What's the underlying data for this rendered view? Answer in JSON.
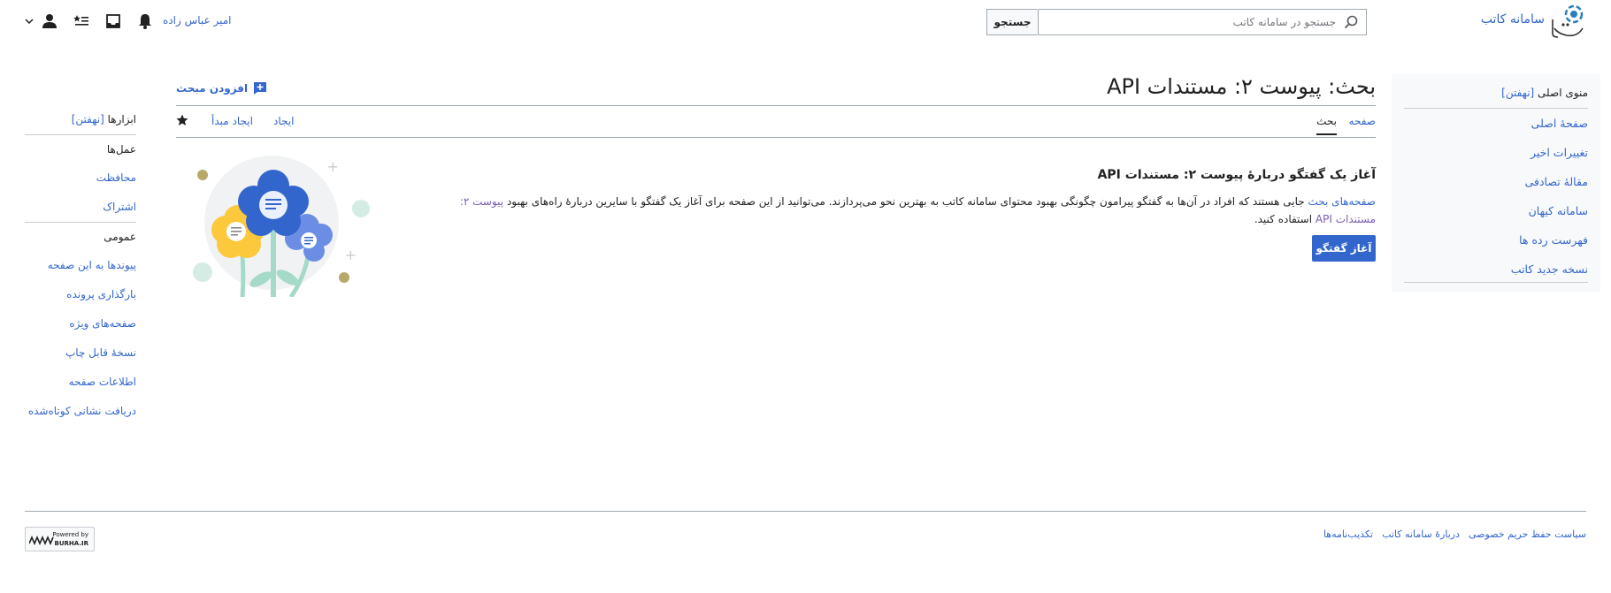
{
  "header": {
    "site_name": "سامانه کاتب",
    "search_placeholder": "جستجو در سامانه کاتب",
    "search_button": "جستجو",
    "username": "امیر عباس زاده"
  },
  "main_menu": {
    "title": "منوی اصلی",
    "hide": "[نهفتن]",
    "items": [
      "صفحهٔ اصلی",
      "تغییرات اخیر",
      "مقالهٔ تصادفی",
      "سامانه کیهان",
      "فهرست رده ها",
      "نسخه جدید کاتب"
    ]
  },
  "page": {
    "title": "بحث: پیوست ۲: مستندات API",
    "add_topic": "افزودن مبحث",
    "tabs": {
      "page": "صفحه",
      "talk": "بحث",
      "create": "ایجاد",
      "create_source": "ایجاد مبدأ"
    }
  },
  "empty_state": {
    "heading": "آغاز یک گفتگو دربارهٔ پیوست ۲: مستندات API",
    "link_talk_pages": "صفحه‌های بحث",
    "desc_part1": " جایی هستند که افراد در آن‌ها به گفتگو پیرامون چگونگی بهبود محتوای سامانه کاتب به بهترین نحو می‌پردازند. می‌توانید از این صفحه برای آغاز یک گفتگو با سایرین دربارهٔ راه‌های بهبود ",
    "link_page": "پیوست ۲: مستندات API",
    "desc_part2": " استفاده کنید.",
    "button": "آغاز گفتگو"
  },
  "tools": {
    "title": "ابزارها",
    "hide": "[نهفتن]",
    "actions_heading": "عمل‌ها",
    "actions": [
      "محافظت",
      "اشتراک"
    ],
    "general_heading": "عمومی",
    "general": [
      "پیوندها به این صفحه",
      "بارگذاری پرونده",
      "صفحه‌های ویژه",
      "نسخهٔ قابل چاپ",
      "اطلاعات صفحه",
      "دریافت نشانی کوتاه‌شده"
    ]
  },
  "footer": {
    "links": [
      "سیاست حفظ حریم خصوصی",
      "دربارهٔ سامانه کاتب",
      "تکذیب‌نامه‌ها"
    ],
    "powered_line1": "Powered by",
    "powered_line2": "BURHA.IR"
  },
  "colors": {
    "link": "#3366cc",
    "visited": "#795cb2",
    "button": "#3366cc"
  }
}
